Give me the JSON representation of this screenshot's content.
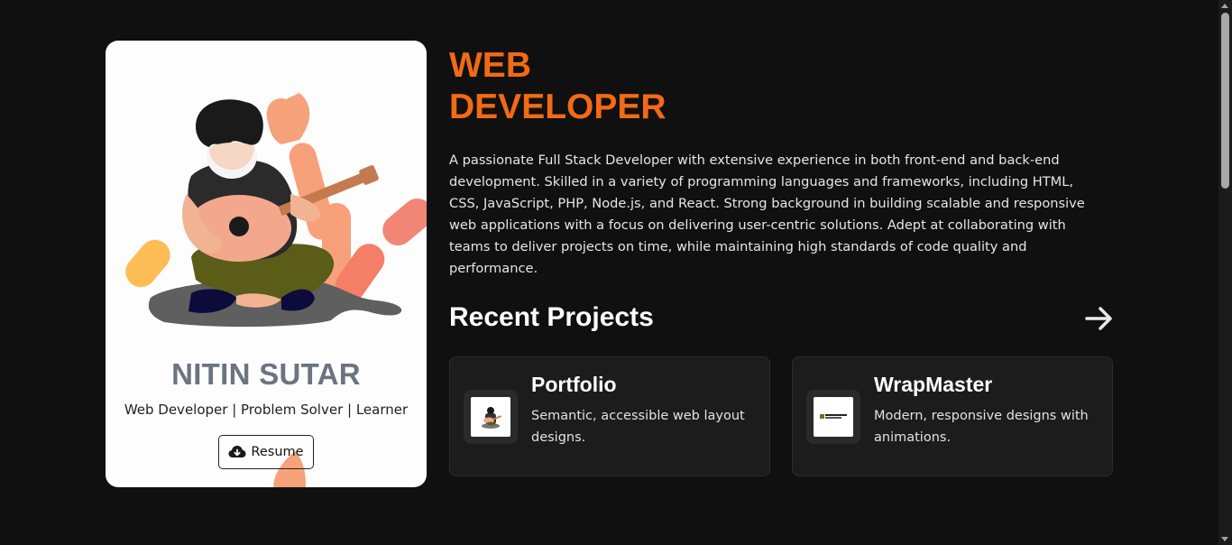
{
  "profile": {
    "name": "NITIN SUTAR",
    "tagline": "Web Developer | Problem Solver | Learner",
    "resume_label": "Resume"
  },
  "hero": {
    "headline_line1": "WEB",
    "headline_line2": "DEVELOPER",
    "bio": "A passionate Full Stack Developer with extensive experience in both front-end and back-end development. Skilled in a variety of programming languages and frameworks, including HTML, CSS, JavaScript, PHP, Node.js, and React. Strong background in building scalable and responsive web applications with a focus on delivering user-centric solutions. Adept at collaborating with teams to deliver projects on time, while maintaining high standards of code quality and performance."
  },
  "projects": {
    "section_title": "Recent Projects",
    "items": [
      {
        "title": "Portfolio",
        "description": "Semantic, accessible web layout designs."
      },
      {
        "title": "WrapMaster",
        "description": "Modern, responsive designs with animations."
      }
    ]
  },
  "colors": {
    "background": "#111010",
    "accent": "#f26a15",
    "card": "#1c1c1c"
  },
  "icons": {
    "resume": "cloud-download-icon",
    "next": "arrow-right-icon"
  }
}
